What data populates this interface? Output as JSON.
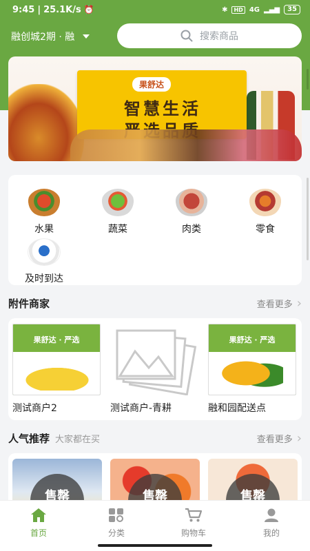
{
  "status_bar": {
    "time": "9:45",
    "speed": "25.1K/s",
    "network": "4G",
    "battery": "35"
  },
  "header": {
    "location": "融创城2期 · 融",
    "search_placeholder": "搜索商品"
  },
  "banner": {
    "brand": "果舒达",
    "slogan_line1": "智慧生活",
    "slogan_line2": "严选品质"
  },
  "categories": [
    {
      "label": "水果",
      "icon": "fruit-basket-icon"
    },
    {
      "label": "蔬菜",
      "icon": "vegetable-icon"
    },
    {
      "label": "肉类",
      "icon": "meat-icon"
    },
    {
      "label": "零食",
      "icon": "snack-icon"
    },
    {
      "label": "及时到达",
      "icon": "delivery-icon"
    }
  ],
  "merchants_section": {
    "title": "附件商家",
    "see_more": "查看更多",
    "items": [
      {
        "name": "测试商户2",
        "banner_tag": "果舒达 · 严选"
      },
      {
        "name": "测试商户-青耕"
      },
      {
        "name": "融和园配送点",
        "banner_tag": "果舒达 · 严选"
      }
    ]
  },
  "popular_section": {
    "title": "人气推荐",
    "subtitle": "大家都在买",
    "see_more": "查看更多",
    "items": [
      {
        "status": "售罄"
      },
      {
        "status": "售罄"
      },
      {
        "status": "售罄"
      }
    ]
  },
  "tabbar": {
    "items": [
      {
        "label": "首页",
        "icon": "home-icon",
        "active": true
      },
      {
        "label": "分类",
        "icon": "category-icon",
        "active": false
      },
      {
        "label": "购物车",
        "icon": "cart-icon",
        "active": false
      },
      {
        "label": "我的",
        "icon": "profile-icon",
        "active": false
      }
    ]
  },
  "colors": {
    "brand_green": "#6aa842",
    "banner_yellow": "#f7c400"
  }
}
